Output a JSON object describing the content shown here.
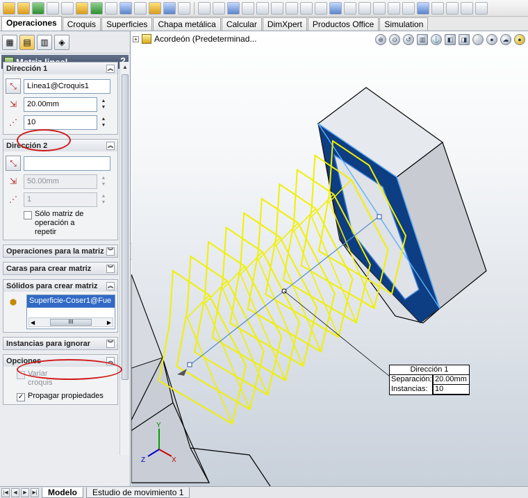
{
  "tabs": [
    "Operaciones",
    "Croquis",
    "Superficies",
    "Chapa metálica",
    "Calcular",
    "DimXpert",
    "Productos Office",
    "Simulation"
  ],
  "property_manager": {
    "title": "Matriz lineal",
    "help_symbol": "?",
    "ok_symbol": "✔",
    "cancel_symbol": "✖"
  },
  "direction1": {
    "header": "Dirección 1",
    "edge": "Línea1@Croquis1",
    "spacing": "20.00mm",
    "instances": "10"
  },
  "direction2": {
    "header": "Dirección 2",
    "edge": "",
    "spacing": "50.00mm",
    "instances": "1",
    "seed_only_label": "Sólo matriz de operación a repetir"
  },
  "collapsed_groups": {
    "features": "Operaciones para la matriz",
    "faces": "Caras para crear matriz"
  },
  "bodies": {
    "header": "Sólidos para crear matriz",
    "item": "Superficie-Coser1@Fue",
    "scroll_grip": "III"
  },
  "skip_instances": "Instancias para ignorar",
  "options": {
    "header": "Opciones",
    "vary_sketch": "Variar croquis",
    "propagate": "Propagar propiedades"
  },
  "viewport": {
    "tree_label": "Acordeón  (Predeterminad...",
    "triad_labels": {
      "x": "X",
      "y": "Y",
      "z": "Z"
    }
  },
  "callout": {
    "title": "Dirección 1",
    "spacing_label": "Separación:",
    "spacing_value": "20.00mm",
    "instances_label": "Instancias:",
    "instances_value": "10"
  },
  "bottom_tabs": [
    "Modelo",
    "Estudio de movimiento 1"
  ],
  "colors": {
    "preview": "#f0f000",
    "body_blue": "#0a3f8a",
    "highlight_oval": "#d11a1a",
    "selection": "#316ac5"
  }
}
